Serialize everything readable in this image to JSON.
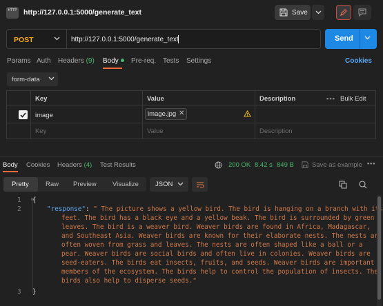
{
  "topbar": {
    "http_icon_text": "HTTP",
    "title": "http://127.0.0.1:5000/generate_text",
    "save_label": "Save"
  },
  "request": {
    "method": "POST",
    "url": "http://127.0.0.1:5000/generate_text",
    "send_label": "Send"
  },
  "request_tabs": {
    "params": "Params",
    "auth": "Auth",
    "headers": "Headers",
    "headers_count": "(9)",
    "body": "Body",
    "prereq": "Pre-req.",
    "tests": "Tests",
    "settings": "Settings",
    "cookies": "Cookies"
  },
  "body_type": "form-data",
  "params_table": {
    "headers": {
      "key": "Key",
      "value": "Value",
      "description": "Description",
      "bulk_edit": "Bulk Edit"
    },
    "rows": [
      {
        "key": "image",
        "value": "image.jpg",
        "checked": true
      }
    ],
    "placeholder": {
      "key": "Key",
      "value": "Value",
      "description": "Description"
    }
  },
  "response": {
    "tabs": {
      "body": "Body",
      "cookies": "Cookies",
      "headers": "Headers",
      "headers_count": "(4)",
      "test_results": "Test Results"
    },
    "status": "200 OK",
    "time": "8.42 s",
    "size": "849 B",
    "save_as_example": "Save as example",
    "view_modes": {
      "pretty": "Pretty",
      "raw": "Raw",
      "preview": "Preview",
      "visualize": "Visualize"
    },
    "format": "JSON",
    "line_numbers": [
      "1",
      "2",
      "3"
    ],
    "open_brace": "{",
    "close_brace": "}",
    "json_key": "\"response\"",
    "colon": ": ",
    "value_lines": [
      "\" The picture shows a yellow bird. The bird is hanging on a branch with its",
      "feet. The bird has a black eye and a yellow beak. The bird is surrounded by green",
      "leaves. The bird is a weaver bird. Weaver birds are found in Africa, Madagascar,",
      "and Southeast Asia. Weaver birds are known for their elaborate nests. The nests are",
      "often woven from grass and leaves. The nests are often shaped like a ball or a",
      "pear. Weaver birds are social birds and often live in colonies. Weaver birds are",
      "seed-eaters. The birds eat insects, fruits, and seeds. Weaver birds are important",
      "members of the ecosystem. The birds help to control the population of insects. The",
      "birds also help to disperse seeds.\""
    ]
  },
  "colors": {
    "accent_orange": "#ff6c37",
    "method_post": "#f5a623",
    "send_blue": "#1e88e5",
    "status_green": "#49b86e",
    "json_key": "#62a8f0",
    "json_string": "#d07a4a"
  }
}
